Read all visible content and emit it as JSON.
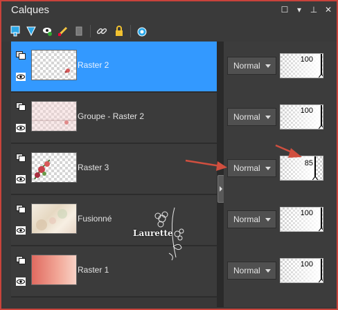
{
  "panel": {
    "title": "Calques",
    "window_buttons": [
      "restore-icon",
      "menu-arrow-icon",
      "pin-icon",
      "close-icon"
    ]
  },
  "toolbar": {
    "tools": [
      "new-raster-layer-icon",
      "new-vector-layer-icon",
      "layer-visibility-icon",
      "layer-edit-icon",
      "layer-delete-icon",
      "link-icon",
      "lock-icon",
      "mask-icon"
    ]
  },
  "layers": [
    {
      "name": "Raster 2",
      "selected": true,
      "blend_mode": "Normal",
      "opacity": 100
    },
    {
      "name": "Groupe - Raster 2",
      "selected": false,
      "blend_mode": "Normal",
      "opacity": 100
    },
    {
      "name": "Raster 3",
      "selected": false,
      "blend_mode": "Normal",
      "opacity": 85
    },
    {
      "name": "Fusionné",
      "selected": false,
      "blend_mode": "Normal",
      "opacity": 100
    },
    {
      "name": "Raster 1",
      "selected": false,
      "blend_mode": "Normal",
      "opacity": 100
    }
  ],
  "watermark": {
    "text": "Laurette"
  },
  "colors": {
    "selected_row": "#3399ff",
    "panel_bg": "#383838",
    "frame_border": "#c9433b",
    "annotation_arrow": "#d04f3f"
  }
}
